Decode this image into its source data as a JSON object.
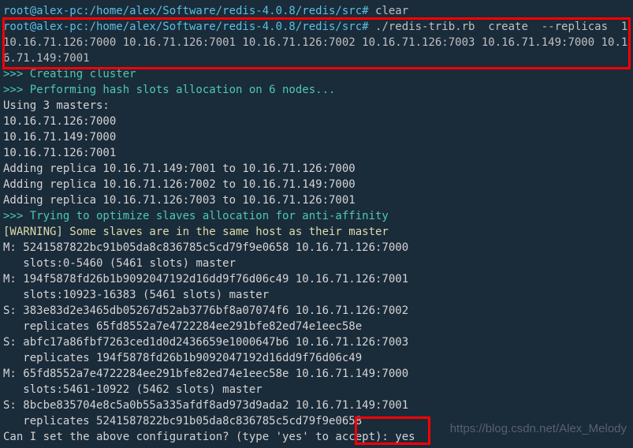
{
  "lines": [
    {
      "class": "prompt",
      "text": "root@alex-pc:/home/alex/Software/redis-4.0.8/redis/src# clear"
    },
    {
      "class": "prompt",
      "text": "root@alex-pc:/home/alex/Software/redis-4.0.8/redis/src# ./redis-trib.rb  create  --replicas  1 10.16.71.126:7000 10.16.71.126:7001 10.16.71.126:7002 10.16.71.126:7003 10.16.71.149:7000 10.16.71.149:7001"
    },
    {
      "class": "teal",
      "text": ">>> Creating cluster"
    },
    {
      "class": "teal",
      "text": ">>> Performing hash slots allocation on 6 nodes..."
    },
    {
      "class": "white",
      "text": "Using 3 masters:"
    },
    {
      "class": "white",
      "text": "10.16.71.126:7000"
    },
    {
      "class": "white",
      "text": "10.16.71.149:7000"
    },
    {
      "class": "white",
      "text": "10.16.71.126:7001"
    },
    {
      "class": "white",
      "text": "Adding replica 10.16.71.149:7001 to 10.16.71.126:7000"
    },
    {
      "class": "white",
      "text": "Adding replica 10.16.71.126:7002 to 10.16.71.149:7000"
    },
    {
      "class": "white",
      "text": "Adding replica 10.16.71.126:7003 to 10.16.71.126:7001"
    },
    {
      "class": "teal",
      "text": ">>> Trying to optimize slaves allocation for anti-affinity"
    },
    {
      "class": "yellow",
      "text": "[WARNING] Some slaves are in the same host as their master"
    },
    {
      "class": "white",
      "text": "M: 5241587822bc91b05da8c836785c5cd79f9e0658 10.16.71.126:7000"
    },
    {
      "class": "white",
      "text": "   slots:0-5460 (5461 slots) master"
    },
    {
      "class": "white",
      "text": "M: 194f5878fd26b1b9092047192d16dd9f76d06c49 10.16.71.126:7001"
    },
    {
      "class": "white",
      "text": "   slots:10923-16383 (5461 slots) master"
    },
    {
      "class": "white",
      "text": "S: 383e83d2e3465db05267d52ab3776bf8a07074f6 10.16.71.126:7002"
    },
    {
      "class": "white",
      "text": "   replicates 65fd8552a7e4722284ee291bfe82ed74e1eec58e"
    },
    {
      "class": "white",
      "text": "S: abfc17a86fbf7263ced1d0d2436659e1000647b6 10.16.71.126:7003"
    },
    {
      "class": "white",
      "text": "   replicates 194f5878fd26b1b9092047192d16dd9f76d06c49"
    },
    {
      "class": "white",
      "text": "M: 65fd8552a7e4722284ee291bfe82ed74e1eec58e 10.16.71.149:7000"
    },
    {
      "class": "white",
      "text": "   slots:5461-10922 (5462 slots) master"
    },
    {
      "class": "white",
      "text": "S: 8bcbe835704e8c5a0b55a335afdf8ad973d9ada2 10.16.71.149:7001"
    },
    {
      "class": "white",
      "text": "   replicates 5241587822bc91b05da8c836785c5cd79f9e0658"
    },
    {
      "class": "white",
      "text": "Can I set the above configuration? (type 'yes' to accept): yes"
    }
  ],
  "watermark": "https://blog.csdn.net/Alex_Melody"
}
